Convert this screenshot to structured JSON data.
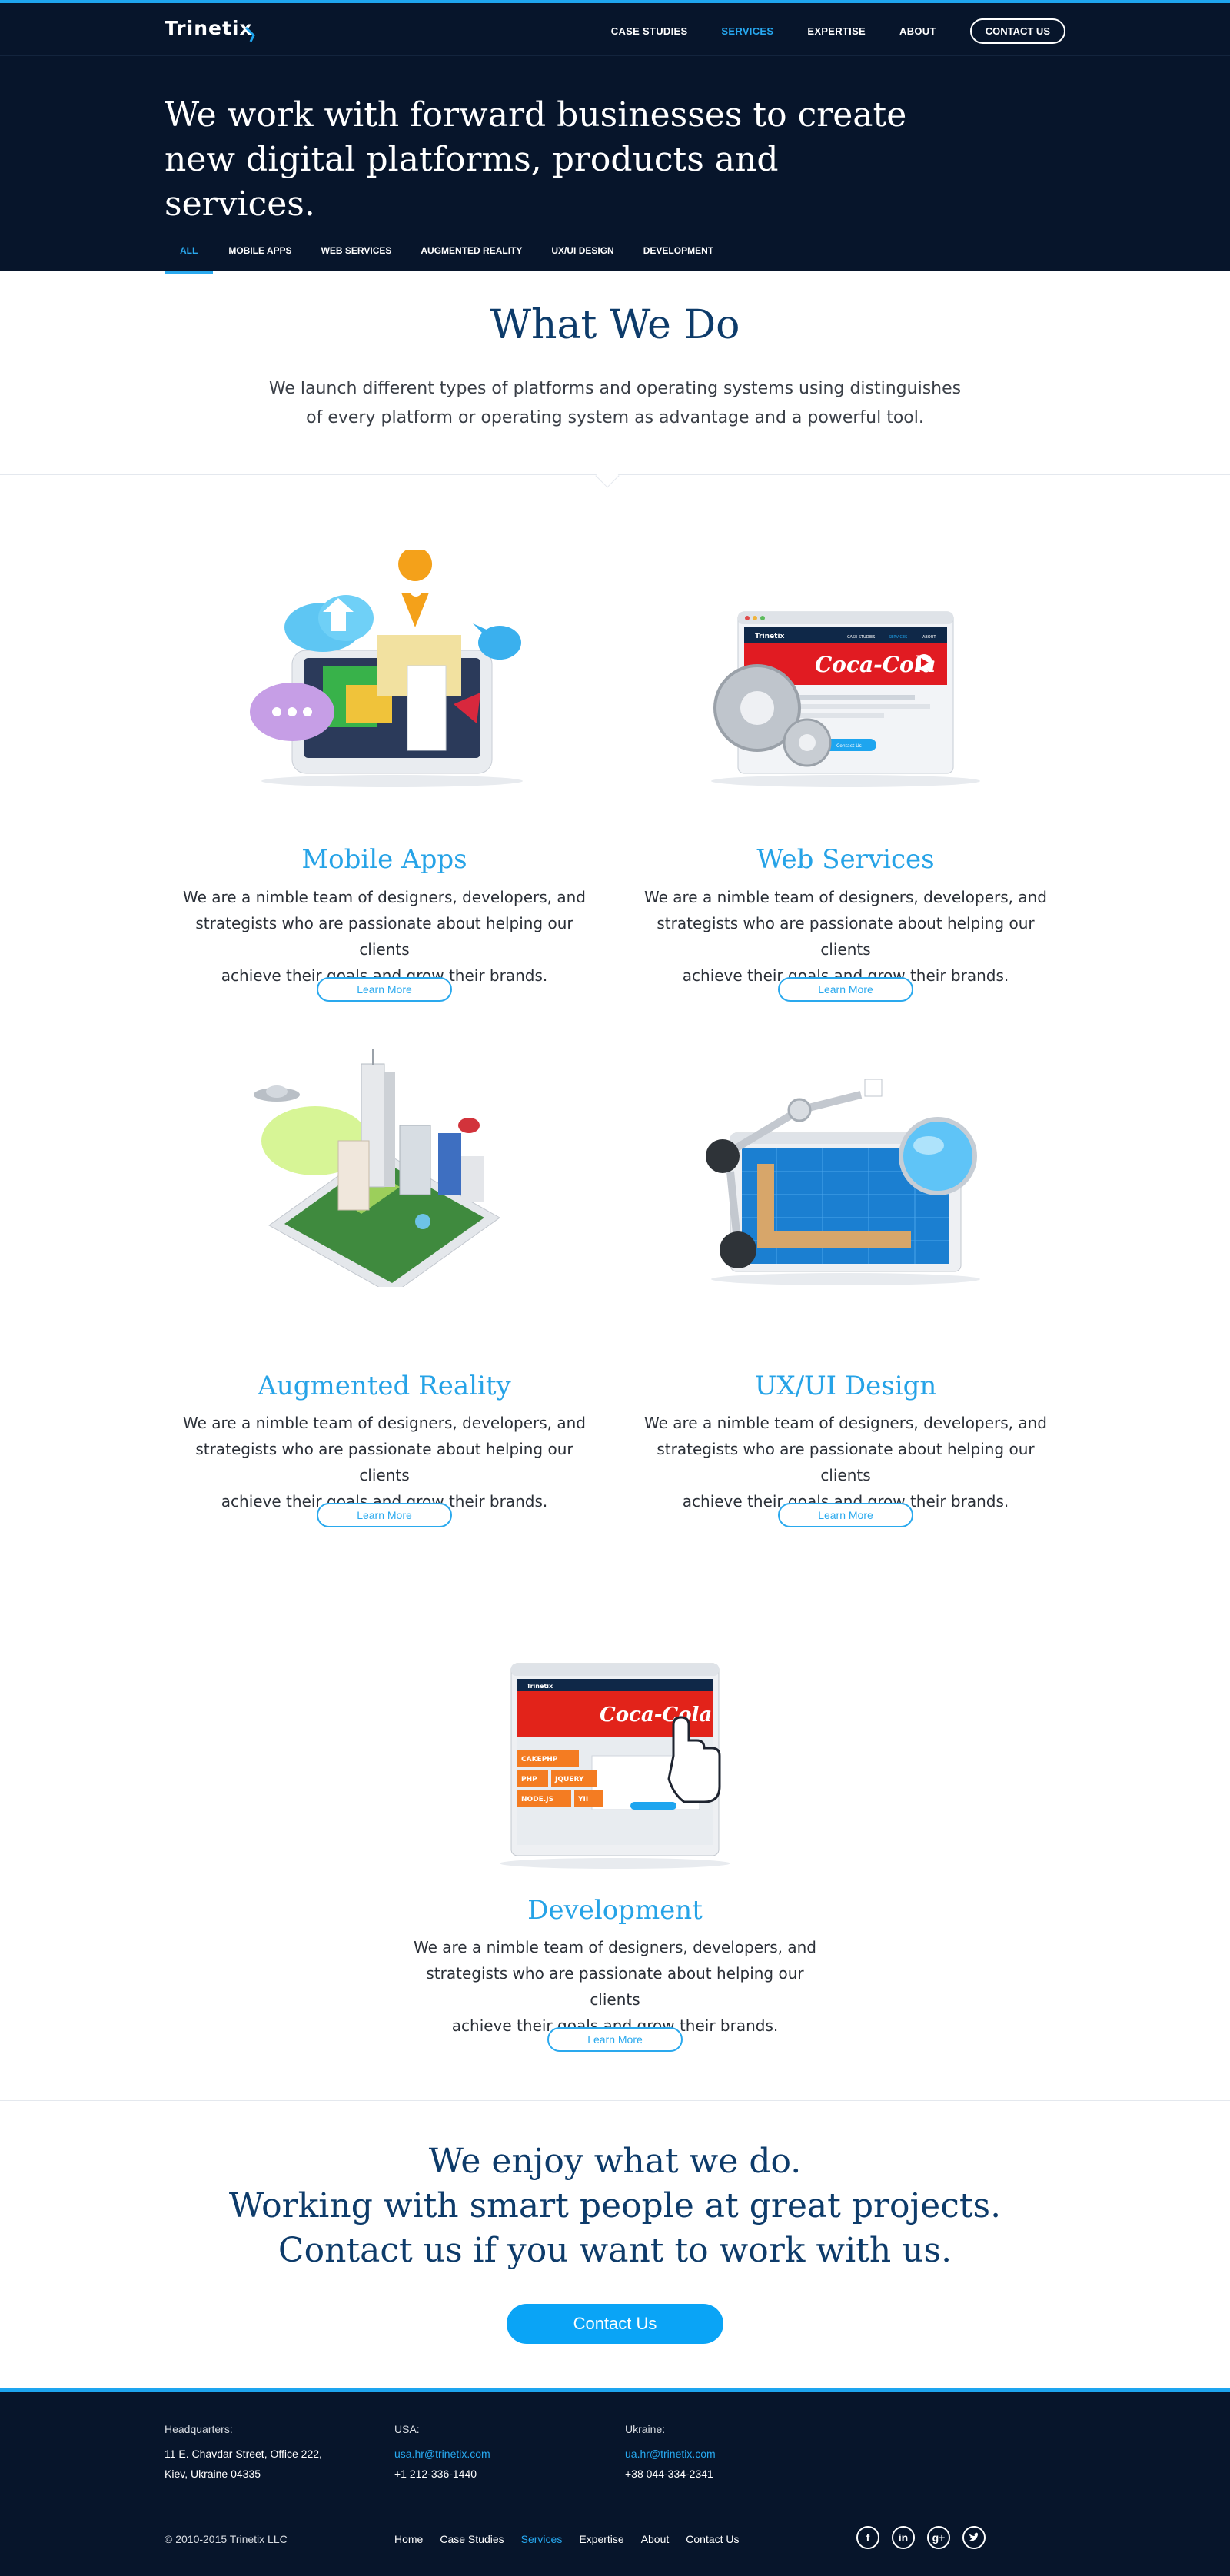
{
  "header": {
    "logo": "Trinetix",
    "nav": [
      "CASE STUDIES",
      "SERVICES",
      "EXPERTISE",
      "ABOUT"
    ],
    "nav_active_index": 1,
    "cta": "CONTACT US",
    "hero_line1": "We work with forward businesses to create",
    "hero_line2": "new digital platforms, products and services.",
    "filters": [
      "ALL",
      "MOBILE APPS",
      "WEB SERVICES",
      "AUGMENTED REALITY",
      "UX/UI DESIGN",
      "DEVELOPMENT"
    ],
    "filter_active_index": 0
  },
  "what_we_do": {
    "title": "What We Do",
    "desc_line1": "We launch different types of platforms and operating systems using distinguishes",
    "desc_line2": "of every platform or operating system as advantage and a powerful tool."
  },
  "services": [
    {
      "title": "Mobile Apps",
      "desc1": "We are a nimble team of designers, developers, and",
      "desc2": "strategists who are passionate about helping our clients",
      "desc3": "achieve their goals and grow their brands.",
      "button": "Learn More",
      "illus": "mobile-apps-illustration"
    },
    {
      "title": "Web Services",
      "desc1": "We are a nimble team of designers, developers, and",
      "desc2": "strategists who are passionate about helping our clients",
      "desc3": "achieve their goals and grow their brands.",
      "button": "Learn More",
      "illus": "web-services-illustration"
    },
    {
      "title": "Augmented Reality",
      "desc1": "We are a nimble team of designers, developers, and",
      "desc2": "strategists who are passionate about helping our clients",
      "desc3": "achieve their goals and grow their brands.",
      "button": "Learn More",
      "illus": "augmented-reality-illustration"
    },
    {
      "title": "UX/UI Design",
      "desc1": "We are a nimble team of designers, developers, and",
      "desc2": "strategists who are passionate about helping our clients",
      "desc3": "achieve their goals and grow their brands.",
      "button": "Learn More",
      "illus": "ux-ui-design-illustration"
    },
    {
      "title": "Development",
      "desc1": "We are a nimble team of designers, developers, and",
      "desc2": "strategists who are passionate about helping our clients",
      "desc3": "achieve their goals and grow their brands.",
      "button": "Learn More",
      "illus": "development-illustration"
    }
  ],
  "illustration_text": {
    "browser_logo": "Trinetix",
    "browser_nav": [
      "CASE STUDIES",
      "SERVICES",
      "ABOUT"
    ],
    "brand": "Coca-Cola",
    "contact_pill": "Contact Us",
    "tech_tags": [
      "CAKEPHP",
      "PHP",
      "JQUERY",
      "NODE.JS",
      "YII"
    ]
  },
  "cta": {
    "line1": "We enjoy what we do.",
    "line2": "Working with smart people at great projects.",
    "line3": "Contact us if you want to work with us.",
    "button": "Contact Us"
  },
  "footer": {
    "hq_label": "Headquarters:",
    "hq_line1": "11 E. Chavdar Street, Office 222,",
    "hq_line2": "Kiev, Ukraine 04335",
    "usa_label": "USA:",
    "usa_email": "usa.hr@trinetix.com",
    "usa_phone": "+1 212-336-1440",
    "ua_label": "Ukraine:",
    "ua_email": "ua.hr@trinetix.com",
    "ua_phone": "+38 044-334-2341",
    "copyright": "© 2010-2015 Trinetix LLC",
    "nav": [
      "Home",
      "Case Studies",
      "Services",
      "Expertise",
      "About",
      "Contact Us"
    ],
    "nav_active_index": 2,
    "social": [
      "facebook-icon",
      "linkedin-icon",
      "google-plus-icon",
      "twitter-icon"
    ]
  },
  "colors": {
    "navy": "#07152b",
    "accent": "#1ea5ef",
    "heading": "#0d3b6a",
    "service_title": "#26a3e7",
    "cta_button": "#0aa4f6"
  }
}
